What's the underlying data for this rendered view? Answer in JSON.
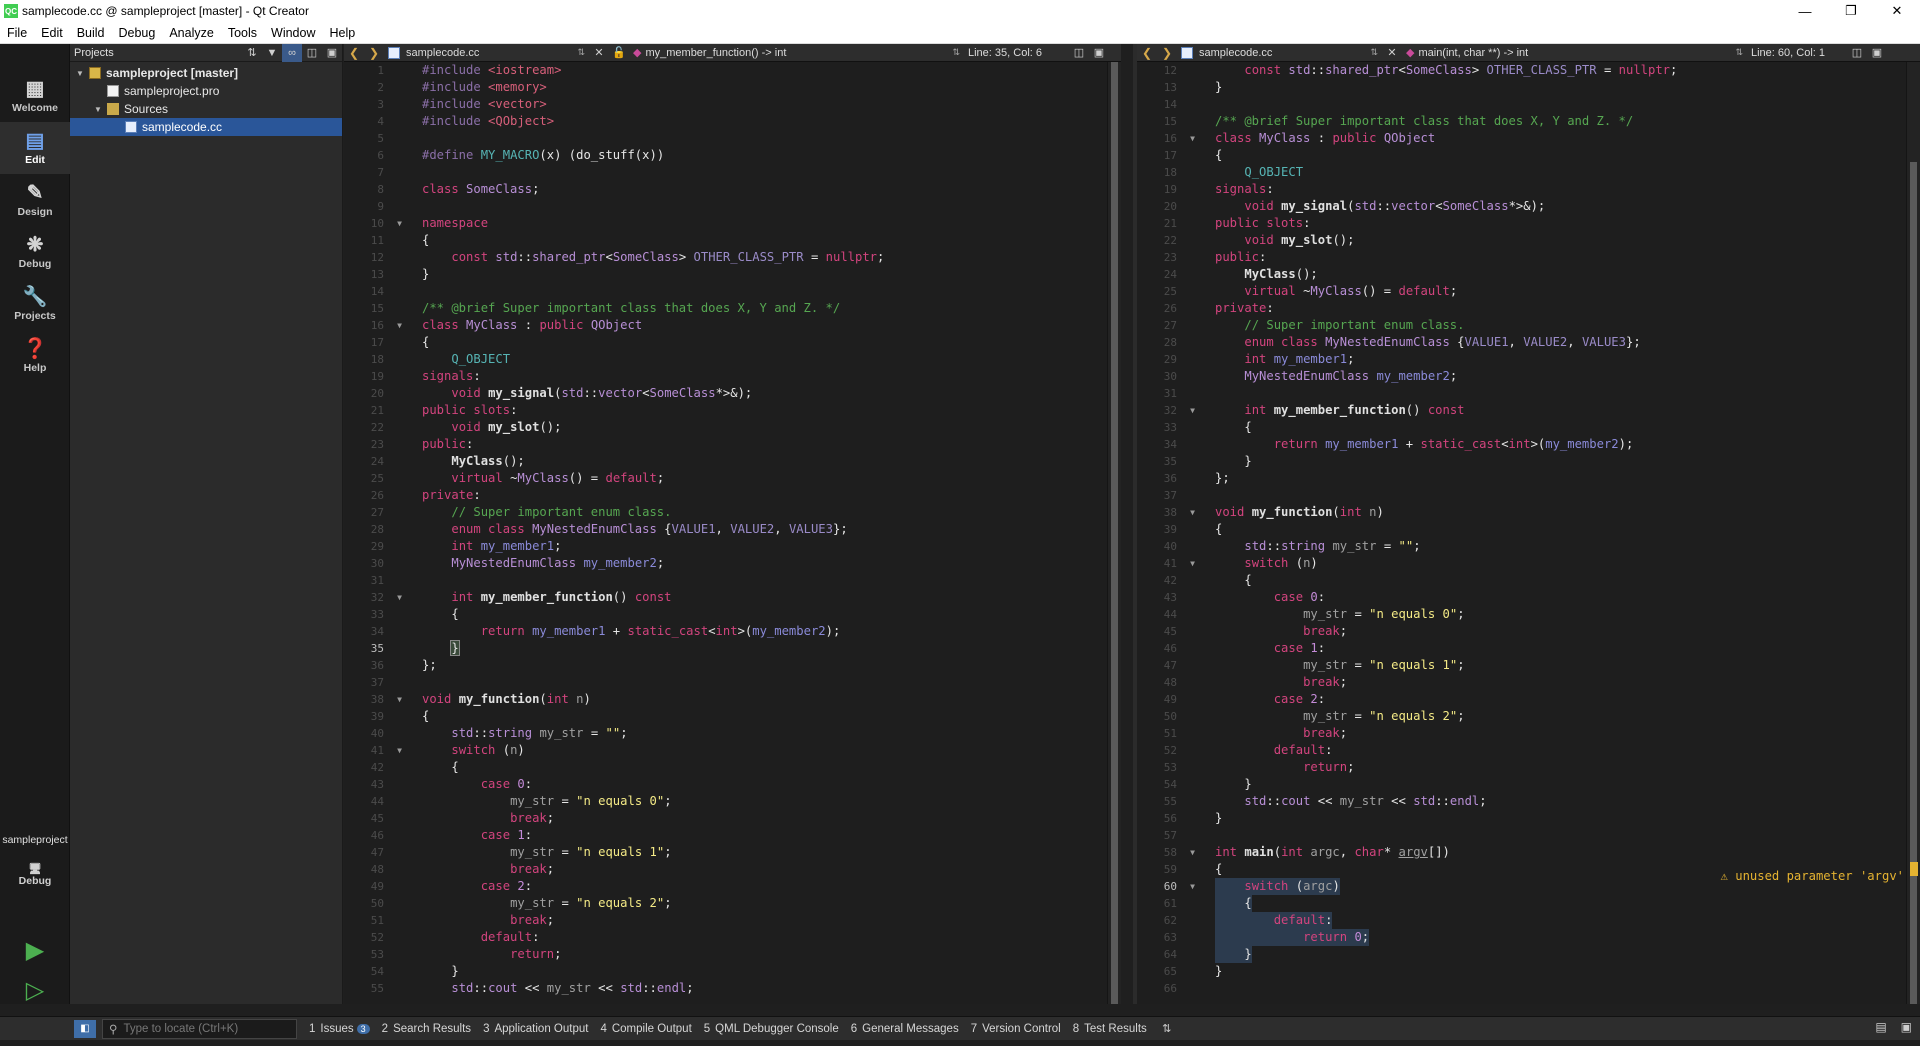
{
  "window": {
    "title": "samplecode.cc @ sampleproject [master] - Qt Creator",
    "app_icon": "QC"
  },
  "menu": [
    "File",
    "Edit",
    "Build",
    "Debug",
    "Analyze",
    "Tools",
    "Window",
    "Help"
  ],
  "modes": [
    {
      "label": "Welcome",
      "icon": "grid-icon"
    },
    {
      "label": "Edit",
      "icon": "document-icon"
    },
    {
      "label": "Design",
      "icon": "pen-icon"
    },
    {
      "label": "Debug",
      "icon": "bug-icon"
    },
    {
      "label": "Projects",
      "icon": "wrench-icon"
    },
    {
      "label": "Help",
      "icon": "question-icon"
    }
  ],
  "kit": {
    "project": "sampleproject",
    "mode": "Debug"
  },
  "projects_pane": {
    "title": "Projects",
    "tree": [
      {
        "label": "sampleproject [master]",
        "level": 0
      },
      {
        "label": "sampleproject.pro",
        "level": 1
      },
      {
        "label": "Sources",
        "level": 1
      },
      {
        "label": "samplecode.cc",
        "level": 2,
        "selected": true
      }
    ]
  },
  "left_editor": {
    "file": "samplecode.cc",
    "symbol": "my_member_function() -> int",
    "position": "Line: 35, Col: 6",
    "first_line": 1,
    "current_line": 35
  },
  "right_editor": {
    "file": "samplecode.cc",
    "symbol": "main(int, char **) -> int",
    "position": "Line: 60, Col: 1",
    "first_line": 12,
    "current_line": 60,
    "warning_line": 58,
    "warning_text": "unused parameter 'argv'"
  },
  "statusbar": {
    "locator_placeholder": "Type to locate (Ctrl+K)",
    "tabs": [
      {
        "num": "1",
        "label": "Issues",
        "badge": "3"
      },
      {
        "num": "2",
        "label": "Search Results"
      },
      {
        "num": "3",
        "label": "Application Output"
      },
      {
        "num": "4",
        "label": "Compile Output"
      },
      {
        "num": "5",
        "label": "QML Debugger Console"
      },
      {
        "num": "6",
        "label": "General Messages"
      },
      {
        "num": "7",
        "label": "Version Control"
      },
      {
        "num": "8",
        "label": "Test Results"
      }
    ]
  },
  "colors": {
    "accent": "#2a5699",
    "warning": "#e5b331",
    "keyword": "#d2447e",
    "comment": "#56a651"
  },
  "source_lines": [
    "<span class=\"pp\">#include</span> <span class=\"inc\">&lt;iostream&gt;</span>",
    "<span class=\"pp\">#include</span> <span class=\"inc\">&lt;memory&gt;</span>",
    "<span class=\"pp\">#include</span> <span class=\"inc\">&lt;vector&gt;</span>",
    "<span class=\"pp\">#include</span> <span class=\"inc\">&lt;QObject&gt;</span>",
    "",
    "<span class=\"pp\">#define</span> <span class=\"mc\">MY_MACRO</span><span class=\"tx\">(x) (do_stuff(x))</span>",
    "",
    "<span class=\"kw\">class</span> <span class=\"ty\">SomeClass</span><span class=\"tx\">;</span>",
    "",
    "<span class=\"kw\">namespace</span>",
    "<span class=\"tx\">{</span>",
    "    <span class=\"kw\">const</span> <span class=\"ty\">std</span><span class=\"tx\">::</span><span class=\"ty\">shared_ptr</span><span class=\"tx\">&lt;</span><span class=\"ty\">SomeClass</span><span class=\"tx\">&gt;</span> <span class=\"en\">OTHER_CLASS_PTR</span> <span class=\"tx\">=</span> <span class=\"kw\">nullptr</span><span class=\"tx\">;</span>",
    "<span class=\"tx\">}</span>",
    "",
    "<span class=\"cm\">/** @brief Super important class that does X, Y and Z. */</span>",
    "<span class=\"kw\">class</span> <span class=\"ty\">MyClass</span> <span class=\"tx\">:</span> <span class=\"kw\">public</span> <span class=\"ty\">QObject</span>",
    "<span class=\"tx\">{</span>",
    "    <span class=\"mc\">Q_OBJECT</span>",
    "<span class=\"kw\">signals</span><span class=\"tx\">:</span>",
    "    <span class=\"kw\">void</span> <span class=\"fn\">my_signal</span><span class=\"tx\">(</span><span class=\"ty\">std</span><span class=\"tx\">::</span><span class=\"ty\">vector</span><span class=\"tx\">&lt;</span><span class=\"ty\">SomeClass</span><span class=\"tx\">*&gt;&amp;);</span>",
    "<span class=\"kw\">public slots</span><span class=\"tx\">:</span>",
    "    <span class=\"kw\">void</span> <span class=\"fn\">my_slot</span><span class=\"tx\">();</span>",
    "<span class=\"kw\">public</span><span class=\"tx\">:</span>",
    "    <span class=\"fn\">MyClass</span><span class=\"tx\">();</span>",
    "    <span class=\"kw\">virtual</span> <span class=\"tx\">~</span><span class=\"ty\">MyClass</span><span class=\"tx\">() =</span> <span class=\"kw\">default</span><span class=\"tx\">;</span>",
    "<span class=\"kw\">private</span><span class=\"tx\">:</span>",
    "    <span class=\"cm\">// Super important enum class.</span>",
    "    <span class=\"kw\">enum class</span> <span class=\"ty\">MyNestedEnumClass</span> <span class=\"tx\">{</span><span class=\"en\">VALUE1</span><span class=\"tx\">,</span> <span class=\"en\">VALUE2</span><span class=\"tx\">,</span> <span class=\"en\">VALUE3</span><span class=\"tx\">};</span>",
    "    <span class=\"kw\">int</span> <span class=\"mem\">my_member1</span><span class=\"tx\">;</span>",
    "    <span class=\"ty\">MyNestedEnumClass</span> <span class=\"mem\">my_member2</span><span class=\"tx\">;</span>",
    "",
    "    <span class=\"kw\">int</span> <span class=\"fn\">my_member_function</span><span class=\"tx\">()</span> <span class=\"kw\">const</span>",
    "    <span class=\"tx\">{</span>",
    "        <span class=\"kw\">return</span> <span class=\"mem\">my_member1</span> <span class=\"tx\">+</span> <span class=\"kw\">static_cast</span><span class=\"tx\">&lt;</span><span class=\"kw\">int</span><span class=\"tx\">&gt;(</span><span class=\"mem\">my_member2</span><span class=\"tx\">);</span>",
    "    <span class=\"tx\">}</span>",
    "<span class=\"tx\">};</span>",
    "",
    "<span class=\"kw\">void</span> <span class=\"fn\">my_function</span><span class=\"tx\">(</span><span class=\"kw\">int</span> <span class=\"dim\">n</span><span class=\"tx\">)</span>",
    "<span class=\"tx\">{</span>",
    "    <span class=\"ty\">std</span><span class=\"tx\">::</span><span class=\"ty\">string</span> <span class=\"dim\">my_str</span> <span class=\"tx\">=</span> <span class=\"str\">\"\"</span><span class=\"tx\">;</span>",
    "    <span class=\"kw\">switch</span> <span class=\"tx\">(</span><span class=\"dim\">n</span><span class=\"tx\">)</span>",
    "    <span class=\"tx\">{</span>",
    "        <span class=\"kw\">case</span> <span class=\"num\">0</span><span class=\"tx\">:</span>",
    "            <span class=\"dim\">my_str</span> <span class=\"tx\">=</span> <span class=\"str\">\"n equals 0\"</span><span class=\"tx\">;</span>",
    "            <span class=\"kw\">break</span><span class=\"tx\">;</span>",
    "        <span class=\"kw\">case</span> <span class=\"num\">1</span><span class=\"tx\">:</span>",
    "            <span class=\"dim\">my_str</span> <span class=\"tx\">=</span> <span class=\"str\">\"n equals 1\"</span><span class=\"tx\">;</span>",
    "            <span class=\"kw\">break</span><span class=\"tx\">;</span>",
    "        <span class=\"kw\">case</span> <span class=\"num\">2</span><span class=\"tx\">:</span>",
    "            <span class=\"dim\">my_str</span> <span class=\"tx\">=</span> <span class=\"str\">\"n equals 2\"</span><span class=\"tx\">;</span>",
    "            <span class=\"kw\">break</span><span class=\"tx\">;</span>",
    "        <span class=\"kw\">default</span><span class=\"tx\">:</span>",
    "            <span class=\"kw\">return</span><span class=\"tx\">;</span>",
    "    <span class=\"tx\">}</span>",
    "    <span class=\"ty\">std</span><span class=\"tx\">::</span><span class=\"ty\">cout</span> <span class=\"tx\">&lt;&lt;</span> <span class=\"dim\">my_str</span> <span class=\"tx\">&lt;&lt;</span> <span class=\"ty\">std</span><span class=\"tx\">::</span><span class=\"ty\">endl</span><span class=\"tx\">;</span>",
    "<span class=\"tx\">}</span>",
    "",
    "<span class=\"kw\">int</span> <span class=\"fn\">main</span><span class=\"tx\">(</span><span class=\"kw\">int</span> <span class=\"dim\">argc</span><span class=\"tx\">,</span> <span class=\"kw\">char</span><span class=\"tx\">*</span> <span class=\"dim\" style=\"text-decoration:underline\">argv</span><span class=\"tx\">[])</span>",
    "<span class=\"tx\">{</span>",
    "    <span class=\"kw\">switch</span> <span class=\"tx\">(</span><span class=\"dim\">argc</span><span class=\"tx\">)</span>",
    "    <span class=\"tx\">{</span>",
    "        <span class=\"kw\">default</span><span class=\"tx\">:</span>",
    "            <span class=\"kw\">return</span> <span class=\"num\">0</span><span class=\"tx\">;</span>",
    "    <span class=\"tx\">}</span>",
    "<span class=\"tx\">}</span>",
    ""
  ],
  "fold_lines": [
    10,
    16,
    32,
    38,
    41,
    58,
    60
  ],
  "right_selected_lines": [
    60,
    61,
    62,
    63,
    64
  ]
}
